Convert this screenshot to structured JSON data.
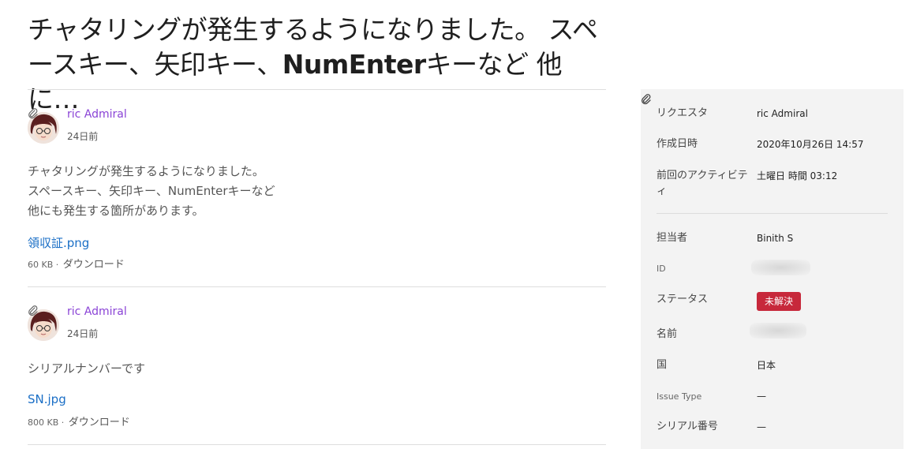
{
  "ticket": {
    "title_part1": "チャタリングが発生するようになりました。 スペースキー、矢印キー、",
    "title_bold": "NumEnter",
    "title_part2": "キーなど 他に…"
  },
  "comments": [
    {
      "author": "ric Admiral",
      "time": "24日前",
      "body_lines": [
        "チャタリングが発生するようになりました。",
        "スペースキー、矢印キー、NumEnterキーなど",
        "他にも発生する箇所があります。"
      ],
      "attachment": {
        "name": "領収証.png",
        "size": "60 KB",
        "separator": "·",
        "download": "ダウンロード"
      }
    },
    {
      "author": "ric Admiral",
      "time": "24日前",
      "body_lines": [
        "シリアルナンバーです"
      ],
      "attachment": {
        "name": "SN.jpg",
        "size": "800 KB",
        "separator": "·",
        "download": "ダウンロード"
      }
    }
  ],
  "sidebar": {
    "requester": {
      "label": "リクエスタ",
      "value": "ric Admiral"
    },
    "created": {
      "label": "作成日時",
      "value": "2020年10月26日 14:57"
    },
    "last_activity": {
      "label": "前回のアクティビティ",
      "value": "土曜日 時間 03:12"
    },
    "assignee": {
      "label": "担当者",
      "value": "Binith S"
    },
    "id": {
      "label": "ID",
      "value": ""
    },
    "status": {
      "label": "ステータス",
      "value": "未解決",
      "color": "#c7283b"
    },
    "name": {
      "label": "名前",
      "value": ""
    },
    "country": {
      "label": "国",
      "value": "日本"
    },
    "issue_type": {
      "label": "Issue Type",
      "value": "—"
    },
    "serial": {
      "label": "シリアル番号",
      "value": "—"
    }
  },
  "colors": {
    "author": "#8a43d6",
    "link": "#1b6fc6",
    "sidebar_bg": "#f3f3f3"
  },
  "icons": {
    "attachment": "paperclip-icon"
  }
}
